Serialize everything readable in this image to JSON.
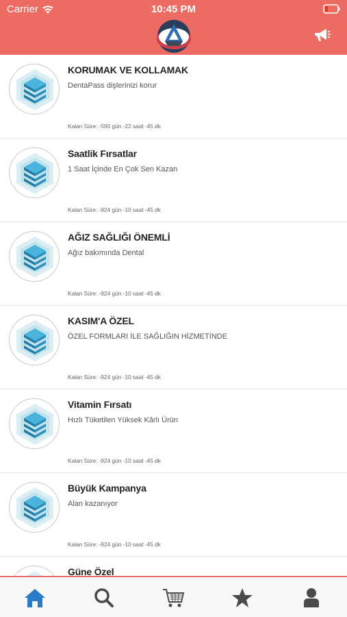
{
  "status_bar": {
    "carrier": "Carrier",
    "time": "10:45 PM"
  },
  "header": {
    "logo": "app-logo",
    "action_icon": "megaphone-icon"
  },
  "campaigns": [
    {
      "title": "KORUMAK VE KOLLAMAK",
      "subtitle": "DentaPass dişlerinizi korur",
      "remaining": "Kalan Süre: -590 gün -22 saat -45 dk"
    },
    {
      "title": "Saatlik Fırsatlar",
      "subtitle": "1 Saat İçinde En Çok Sen Kazan",
      "remaining": "Kalan Süre: -924 gün -10 saat -45 dk"
    },
    {
      "title": "AĞIZ SAĞLIĞI ÖNEMLİ",
      "subtitle": "Ağız bakımında Dental",
      "remaining": "Kalan Süre: -924 gün -10 saat -45 dk"
    },
    {
      "title": "KASIM'A ÖZEL",
      "subtitle": "ÖZEL FORMLARI İLE SAĞLIĞIN HİZMETİNDE",
      "remaining": "Kalan Süre: -924 gün -10 saat -45 dk"
    },
    {
      "title": "Vitamin Fırsatı",
      "subtitle": "Hızlı Tüketilen Yüksek Kârlı Ürün",
      "remaining": "Kalan Süre: -924 gün -10 saat -45 dk"
    },
    {
      "title": "Büyük Kampanya",
      "subtitle": "Alan kazanıyor",
      "remaining": "Kalan Süre: -924 gün -10 saat -45 dk"
    },
    {
      "title": "Güne Özel",
      "subtitle": "",
      "remaining": ""
    }
  ],
  "tabbar": {
    "items": [
      "home-icon",
      "search-icon",
      "cart-icon",
      "star-icon",
      "profile-icon"
    ],
    "active": "home-icon"
  },
  "colors": {
    "header": "#ec6b63",
    "active_tab": "#2b7cc6",
    "inactive_tab": "#4a4a4a",
    "icon_blue": "#3aa0c8"
  }
}
